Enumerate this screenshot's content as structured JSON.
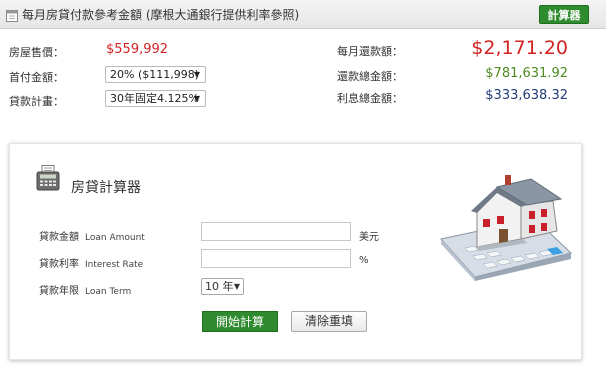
{
  "header": {
    "title": "每月房貸付款參考金額 (摩根大通銀行提供利率參照)",
    "calc_button": "計算器"
  },
  "summary": {
    "price_label": "房屋售價：",
    "price_value": "$559,992",
    "down_label": "首付金額：",
    "down_value": "20% ($111,998)",
    "plan_label": "貸款計畫：",
    "plan_value": "30年固定4.125%",
    "monthly_label": "每月還款額：",
    "monthly_value": "$2,171.20",
    "total_label": "還款總金額：",
    "total_value": "$781,631.92",
    "interest_label": "利息總金額：",
    "interest_value": "$333,638.32"
  },
  "calculator": {
    "title": "房貸計算器",
    "amount_label": "貸款金額",
    "amount_label_en": "Loan Amount",
    "amount_value": "",
    "amount_unit": "美元",
    "rate_label": "貸款利率",
    "rate_label_en": "Interest Rate",
    "rate_value": "",
    "rate_unit": "%",
    "term_label": "貸款年限",
    "term_label_en": "Loan Term",
    "term_value": "10 年",
    "start_button": "開始計算",
    "clear_button": "清除重填"
  },
  "colors": {
    "green": "#2e8b2e",
    "red": "#d32424",
    "olive_green": "#4d8a1e",
    "navy": "#1f3c78"
  }
}
